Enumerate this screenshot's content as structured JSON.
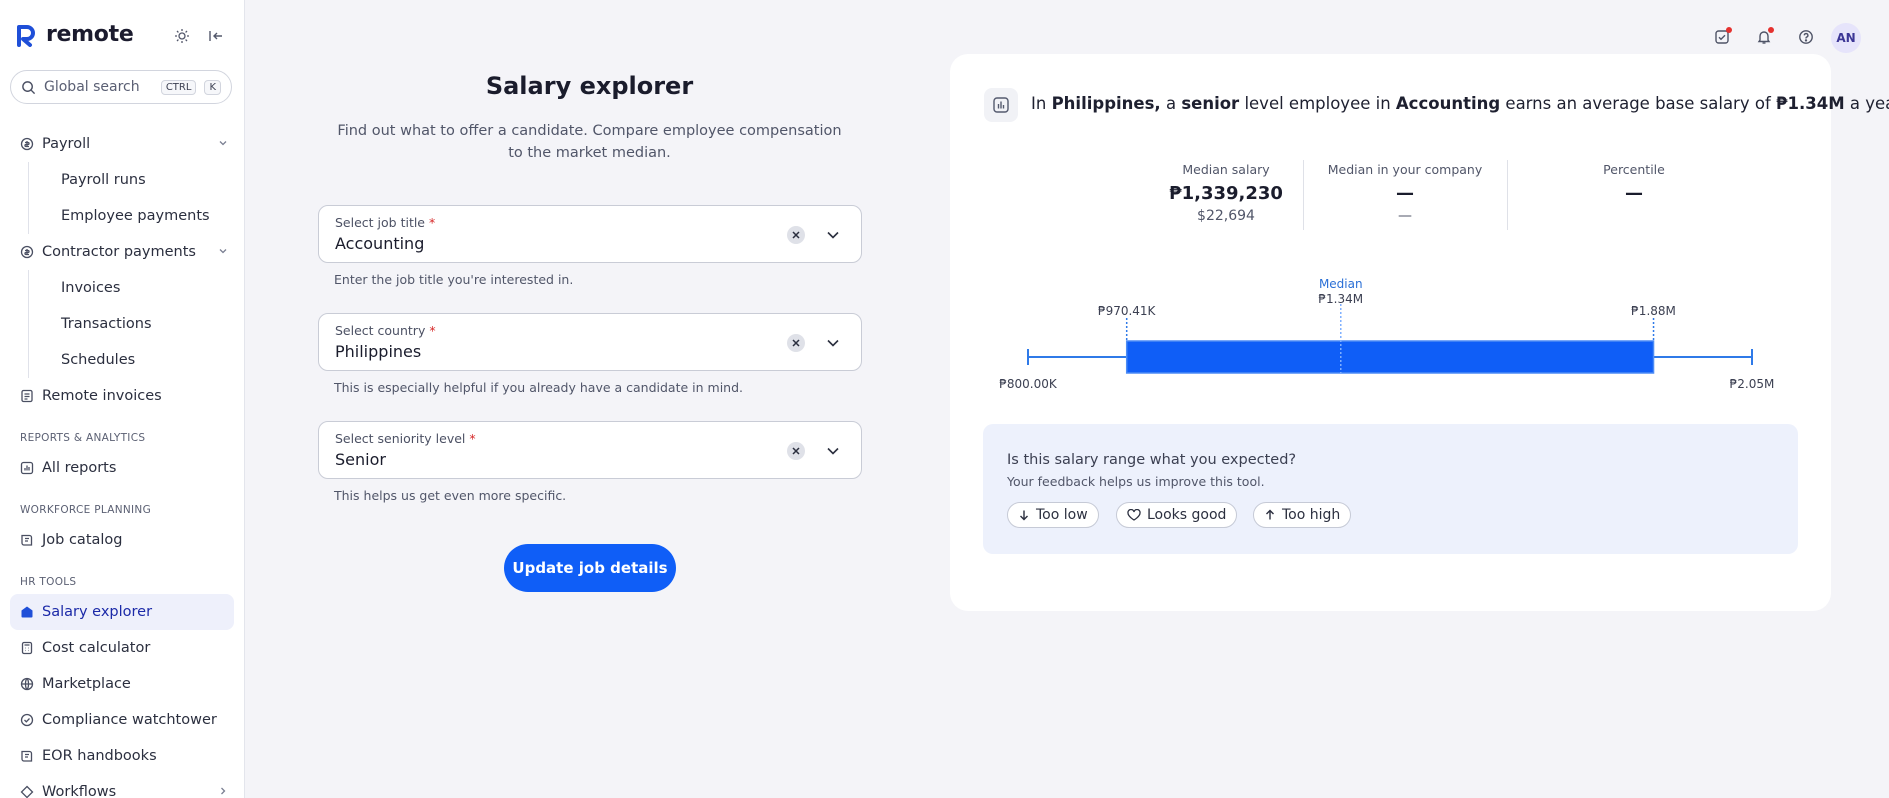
{
  "brand": {
    "name": "remote"
  },
  "search": {
    "placeholder": "Global search",
    "kbd1": "CTRL",
    "kbd2": "K"
  },
  "sidebar": {
    "items": [
      {
        "label": "Payroll"
      },
      {
        "label": "Payroll runs"
      },
      {
        "label": "Employee payments"
      },
      {
        "label": "Contractor payments"
      },
      {
        "label": "Invoices"
      },
      {
        "label": "Transactions"
      },
      {
        "label": "Schedules"
      },
      {
        "label": "Remote invoices"
      },
      {
        "label": "All reports"
      },
      {
        "label": "Job catalog"
      },
      {
        "label": "Salary explorer"
      },
      {
        "label": "Cost calculator"
      },
      {
        "label": "Marketplace"
      },
      {
        "label": "Compliance watchtower"
      },
      {
        "label": "EOR handbooks"
      },
      {
        "label": "Workflows"
      }
    ],
    "sections": {
      "reports": "REPORTS & ANALYTICS",
      "workforce": "WORKFORCE PLANNING",
      "hr": "HR TOOLS"
    }
  },
  "header": {
    "avatar": "AN"
  },
  "form": {
    "title": "Salary explorer",
    "subtitle": "Find out what to offer a candidate. Compare employee compensation to the market median.",
    "job": {
      "label": "Select job title",
      "value": "Accounting",
      "helper": "Enter the job title you're interested in."
    },
    "country": {
      "label": "Select country",
      "value": "Philippines",
      "helper": "This is especially helpful if you already have a candidate in mind."
    },
    "seniority": {
      "label": "Select seniority level",
      "value": "Senior",
      "helper": "This helps us get even more specific."
    },
    "required_mark": "*",
    "submit": "Update job details"
  },
  "result": {
    "summary": {
      "p1": "In ",
      "country": "Philippines,",
      "p2": " a ",
      "level": "senior",
      "p3": " level employee in ",
      "job": "Accounting",
      "p4": " earns an average base salary of ",
      "amount": "₱1.34M",
      "p5": " a year."
    },
    "stats": {
      "median": {
        "label": "Median salary",
        "value": "₱1,339,230",
        "sub": "$22,694"
      },
      "company": {
        "label": "Median in your company",
        "value": "—",
        "sub": "—"
      },
      "percentile": {
        "label": "Percentile",
        "value": "—"
      }
    },
    "feedback": {
      "question": "Is this salary range what you expected?",
      "sub": "Your feedback helps us improve this tool.",
      "too_low": "Too low",
      "looks_good": "Looks good",
      "too_high": "Too high"
    }
  },
  "chart_data": {
    "type": "box",
    "min": 800000,
    "q1": 970410,
    "median": 1340000,
    "q3": 1880000,
    "max": 2050000,
    "labels": {
      "min": "₱800.00K",
      "q1": "₱970.41K",
      "median_title": "Median",
      "median": "₱1.34M",
      "q3": "₱1.88M",
      "max": "₱2.05M"
    },
    "colors": {
      "box": "#0f5ef7",
      "line": "#2f7ae8",
      "median_text": "#2a6fd6"
    }
  }
}
